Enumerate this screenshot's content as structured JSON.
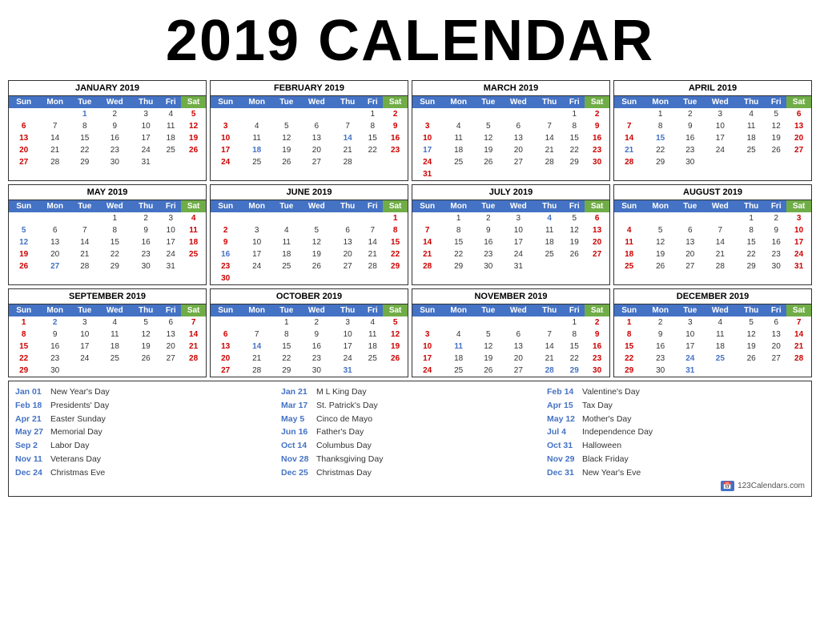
{
  "title": "2019 CALENDAR",
  "months": [
    {
      "name": "JANUARY 2019",
      "weeks": [
        [
          "",
          "",
          "1",
          "2",
          "3",
          "4",
          "5"
        ],
        [
          "6",
          "7",
          "8",
          "9",
          "10",
          "11",
          "12"
        ],
        [
          "13",
          "14",
          "15",
          "16",
          "17",
          "18",
          "19"
        ],
        [
          "20",
          "21",
          "22",
          "23",
          "24",
          "25",
          "26"
        ],
        [
          "27",
          "28",
          "29",
          "30",
          "31",
          "",
          ""
        ]
      ],
      "holidays": {
        "1": true
      }
    },
    {
      "name": "FEBRUARY 2019",
      "weeks": [
        [
          "",
          "",
          "",
          "",
          "",
          "1",
          "2"
        ],
        [
          "3",
          "4",
          "5",
          "6",
          "7",
          "8",
          "9"
        ],
        [
          "10",
          "11",
          "12",
          "13",
          "14",
          "15",
          "16"
        ],
        [
          "17",
          "18",
          "19",
          "20",
          "21",
          "22",
          "23"
        ],
        [
          "24",
          "25",
          "26",
          "27",
          "28",
          "",
          ""
        ]
      ],
      "holidays": {
        "14": true,
        "18": true
      }
    },
    {
      "name": "MARCH 2019",
      "weeks": [
        [
          "",
          "",
          "",
          "",
          "",
          "1",
          "2"
        ],
        [
          "3",
          "4",
          "5",
          "6",
          "7",
          "8",
          "9"
        ],
        [
          "10",
          "11",
          "12",
          "13",
          "14",
          "15",
          "16"
        ],
        [
          "17",
          "18",
          "19",
          "20",
          "21",
          "22",
          "23"
        ],
        [
          "24",
          "25",
          "26",
          "27",
          "28",
          "29",
          "30"
        ],
        [
          "31",
          "",
          "",
          "",
          "",
          "",
          ""
        ]
      ],
      "holidays": {
        "17": true
      }
    },
    {
      "name": "APRIL 2019",
      "weeks": [
        [
          "",
          "1",
          "2",
          "3",
          "4",
          "5",
          "6"
        ],
        [
          "7",
          "8",
          "9",
          "10",
          "11",
          "12",
          "13"
        ],
        [
          "14",
          "15",
          "16",
          "17",
          "18",
          "19",
          "20"
        ],
        [
          "21",
          "22",
          "23",
          "24",
          "25",
          "26",
          "27"
        ],
        [
          "28",
          "29",
          "30",
          "",
          "",
          "",
          ""
        ]
      ],
      "holidays": {
        "15": true,
        "21": true
      }
    },
    {
      "name": "MAY 2019",
      "weeks": [
        [
          "",
          "",
          "",
          "1",
          "2",
          "3",
          "4"
        ],
        [
          "5",
          "6",
          "7",
          "8",
          "9",
          "10",
          "11"
        ],
        [
          "12",
          "13",
          "14",
          "15",
          "16",
          "17",
          "18"
        ],
        [
          "19",
          "20",
          "21",
          "22",
          "23",
          "24",
          "25"
        ],
        [
          "26",
          "27",
          "28",
          "29",
          "30",
          "31",
          ""
        ]
      ],
      "holidays": {
        "5": true,
        "12": true,
        "27": true
      }
    },
    {
      "name": "JUNE 2019",
      "weeks": [
        [
          "",
          "",
          "",
          "",
          "",
          "",
          "1"
        ],
        [
          "2",
          "3",
          "4",
          "5",
          "6",
          "7",
          "8"
        ],
        [
          "9",
          "10",
          "11",
          "12",
          "13",
          "14",
          "15"
        ],
        [
          "16",
          "17",
          "18",
          "19",
          "20",
          "21",
          "22"
        ],
        [
          "23",
          "24",
          "25",
          "26",
          "27",
          "28",
          "29"
        ],
        [
          "30",
          "",
          "",
          "",
          "",
          "",
          ""
        ]
      ],
      "holidays": {
        "16": true
      }
    },
    {
      "name": "JULY 2019",
      "weeks": [
        [
          "",
          "1",
          "2",
          "3",
          "4",
          "5",
          "6"
        ],
        [
          "7",
          "8",
          "9",
          "10",
          "11",
          "12",
          "13"
        ],
        [
          "14",
          "15",
          "16",
          "17",
          "18",
          "19",
          "20"
        ],
        [
          "21",
          "22",
          "23",
          "24",
          "25",
          "26",
          "27"
        ],
        [
          "28",
          "29",
          "30",
          "31",
          "",
          "",
          ""
        ]
      ],
      "holidays": {
        "4": true
      }
    },
    {
      "name": "AUGUST 2019",
      "weeks": [
        [
          "",
          "",
          "",
          "",
          "1",
          "2",
          "3"
        ],
        [
          "4",
          "5",
          "6",
          "7",
          "8",
          "9",
          "10"
        ],
        [
          "11",
          "12",
          "13",
          "14",
          "15",
          "16",
          "17"
        ],
        [
          "18",
          "19",
          "20",
          "21",
          "22",
          "23",
          "24"
        ],
        [
          "25",
          "26",
          "27",
          "28",
          "29",
          "30",
          "31"
        ]
      ],
      "holidays": {}
    },
    {
      "name": "SEPTEMBER 2019",
      "weeks": [
        [
          "1",
          "2",
          "3",
          "4",
          "5",
          "6",
          "7"
        ],
        [
          "8",
          "9",
          "10",
          "11",
          "12",
          "13",
          "14"
        ],
        [
          "15",
          "16",
          "17",
          "18",
          "19",
          "20",
          "21"
        ],
        [
          "22",
          "23",
          "24",
          "25",
          "26",
          "27",
          "28"
        ],
        [
          "29",
          "30",
          "",
          "",
          "",
          "",
          ""
        ]
      ],
      "holidays": {
        "2": true
      }
    },
    {
      "name": "OCTOBER 2019",
      "weeks": [
        [
          "",
          "",
          "1",
          "2",
          "3",
          "4",
          "5"
        ],
        [
          "6",
          "7",
          "8",
          "9",
          "10",
          "11",
          "12"
        ],
        [
          "13",
          "14",
          "15",
          "16",
          "17",
          "18",
          "19"
        ],
        [
          "20",
          "21",
          "22",
          "23",
          "24",
          "25",
          "26"
        ],
        [
          "27",
          "28",
          "29",
          "30",
          "31",
          "",
          ""
        ]
      ],
      "holidays": {
        "14": true,
        "31": true
      }
    },
    {
      "name": "NOVEMBER 2019",
      "weeks": [
        [
          "",
          "",
          "",
          "",
          "",
          "1",
          "2"
        ],
        [
          "3",
          "4",
          "5",
          "6",
          "7",
          "8",
          "9"
        ],
        [
          "10",
          "11",
          "12",
          "13",
          "14",
          "15",
          "16"
        ],
        [
          "17",
          "18",
          "19",
          "20",
          "21",
          "22",
          "23"
        ],
        [
          "24",
          "25",
          "26",
          "27",
          "28",
          "29",
          "30"
        ]
      ],
      "holidays": {
        "11": true,
        "28": true,
        "29": true
      }
    },
    {
      "name": "DECEMBER 2019",
      "weeks": [
        [
          "1",
          "2",
          "3",
          "4",
          "5",
          "6",
          "7"
        ],
        [
          "8",
          "9",
          "10",
          "11",
          "12",
          "13",
          "14"
        ],
        [
          "15",
          "16",
          "17",
          "18",
          "19",
          "20",
          "21"
        ],
        [
          "22",
          "23",
          "24",
          "25",
          "26",
          "27",
          "28"
        ],
        [
          "29",
          "30",
          "31",
          "",
          "",
          "",
          ""
        ]
      ],
      "holidays": {
        "24": true,
        "25": true,
        "31": true
      }
    }
  ],
  "days": [
    "Sun",
    "Mon",
    "Tue",
    "Wed",
    "Thu",
    "Fri",
    "Sat"
  ],
  "holidays": {
    "col1": [
      {
        "date": "Jan 01",
        "name": "New Year's Day"
      },
      {
        "date": "Feb 18",
        "name": "Presidents' Day"
      },
      {
        "date": "Apr 21",
        "name": "Easter Sunday"
      },
      {
        "date": "May 27",
        "name": "Memorial Day"
      },
      {
        "date": "Sep 2",
        "name": "Labor Day"
      },
      {
        "date": "Nov 11",
        "name": "Veterans Day"
      },
      {
        "date": "Dec 24",
        "name": "Christmas Eve"
      }
    ],
    "col2": [
      {
        "date": "Jan 21",
        "name": "M L King Day"
      },
      {
        "date": "Mar 17",
        "name": "St. Patrick's Day"
      },
      {
        "date": "May 5",
        "name": "Cinco de Mayo"
      },
      {
        "date": "Jun 16",
        "name": "Father's Day"
      },
      {
        "date": "Oct 14",
        "name": "Columbus Day"
      },
      {
        "date": "Nov 28",
        "name": "Thanksgiving Day"
      },
      {
        "date": "Dec 25",
        "name": "Christmas Day"
      }
    ],
    "col3": [
      {
        "date": "Feb 14",
        "name": "Valentine's Day"
      },
      {
        "date": "Apr 15",
        "name": "Tax Day"
      },
      {
        "date": "May 12",
        "name": "Mother's Day"
      },
      {
        "date": "Jul 4",
        "name": "Independence Day"
      },
      {
        "date": "Oct 31",
        "name": "Halloween"
      },
      {
        "date": "Nov 29",
        "name": "Black Friday"
      },
      {
        "date": "Dec 31",
        "name": "New Year's Eve"
      }
    ]
  },
  "branding": "123Calendars.com"
}
